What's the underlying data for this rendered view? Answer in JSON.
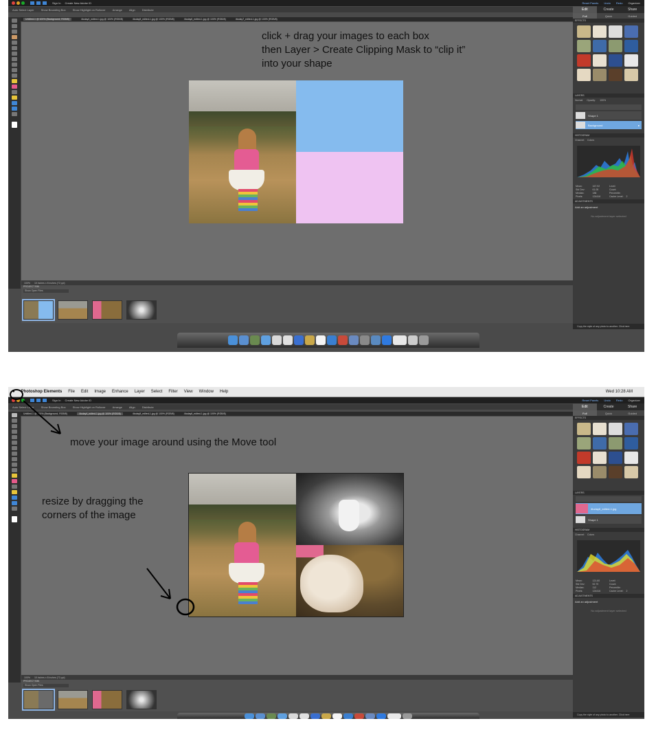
{
  "screenshot_1": {
    "topbar": {
      "items": [
        "Auto Select Layer",
        "Show Bounding Box",
        "Show Highlight on Rollover",
        "Arrange",
        "Align",
        "Distribute"
      ],
      "signin": "Sign In",
      "create_id": "Create New Adobe ID",
      "reset_panels": "Reset Panels",
      "undo": "Undo",
      "redo": "Redo",
      "organizer": "Organizer"
    },
    "tabs": [
      "Untitled-1 @ 100% (Background, RGB/8)",
      "4today4_edited-1.jpg @ 100% (RGB/8)",
      "4today5_edited-1.jpg @ 100% (RGB/8)",
      "4today6_edited-1.jpg @ 100% (RGB/8)",
      "4today7_edited-1.jpg @ 100% (RGB/8)"
    ],
    "annotation": {
      "line1": "click + drag your images to each box",
      "line2": "then Layer > Create Clipping Mask to “clip it”",
      "line3": "into your shape"
    },
    "status": {
      "zoom": "100%",
      "size": "10 inches x 8 inches (72 ppi)"
    },
    "project_bin": {
      "label": "PROJECT BIN",
      "dropdown": "Show Open Files"
    },
    "panel": {
      "tabs": [
        "Edit",
        "Create",
        "Share"
      ],
      "subtabs": [
        "Full",
        "Quick",
        "Guided"
      ],
      "effects_header": "EFFECTS",
      "layers_header": "LAYERS",
      "layers": [
        "Shape 1",
        "Background"
      ],
      "blend_mode": "Normal",
      "opacity_label": "Opacity:",
      "opacity_value": "100%",
      "histogram_header": "HISTOGRAM",
      "channel_label": "Channel:",
      "channel_value": "Colors",
      "stats": [
        "Mean:",
        "167.92",
        "Level:",
        "",
        "Std Dev:",
        "61.05",
        "Count:",
        "",
        "Median:",
        "188",
        "Percentile:",
        "",
        "Pixels:",
        "124416",
        "Cache Level:",
        "2"
      ],
      "adjustments_header": "ADJUSTMENTS",
      "add_adjustment": "Add an adjustment",
      "no_adjustment": "No adjustment layer selected"
    },
    "tip": "Copy the style of any photo to another. Click here"
  },
  "screenshot_2": {
    "menubar": {
      "app": "Photoshop Elements",
      "items": [
        "File",
        "Edit",
        "Image",
        "Enhance",
        "Layer",
        "Select",
        "Filter",
        "View",
        "Window",
        "Help"
      ],
      "clock": "Wed 10:28 AM"
    },
    "topbar": {
      "signin": "Sign In",
      "create_id": "Create New Adobe ID",
      "reset_panels": "Reset Panels",
      "undo": "Undo",
      "redo": "Redo",
      "organizer": "Organizer"
    },
    "annotation": {
      "move": "move your image around using the Move tool",
      "resize_line1": "resize by dragging the",
      "resize_line2": "corners of the image"
    },
    "panel": {
      "tabs": [
        "Edit",
        "Create",
        "Share"
      ],
      "subtabs": [
        "Full",
        "Quick",
        "Guided"
      ],
      "effects_header": "EFFECTS",
      "layers_header": "LAYERS",
      "layers": [
        "4today6_edited-1.jpg",
        "Shape 1"
      ],
      "stats": [
        "Mean:",
        "121.60",
        "Level:",
        "",
        "Std Dev:",
        "52.70",
        "Count:",
        "",
        "Median:",
        "112",
        "Percentile:",
        "",
        "Pixels:",
        "124416",
        "Cache Level:",
        "2"
      ],
      "add_adjustment": "Add an adjustment",
      "no_adjustment": "No adjustment layer selected"
    },
    "tip": "Copy the style of any photo to another. Click here"
  },
  "colors": {
    "blue_box": "#85bbee",
    "pink_box": "#efc3f2",
    "canvas": "#6e6e6e",
    "selection": "#6fa7e0"
  }
}
